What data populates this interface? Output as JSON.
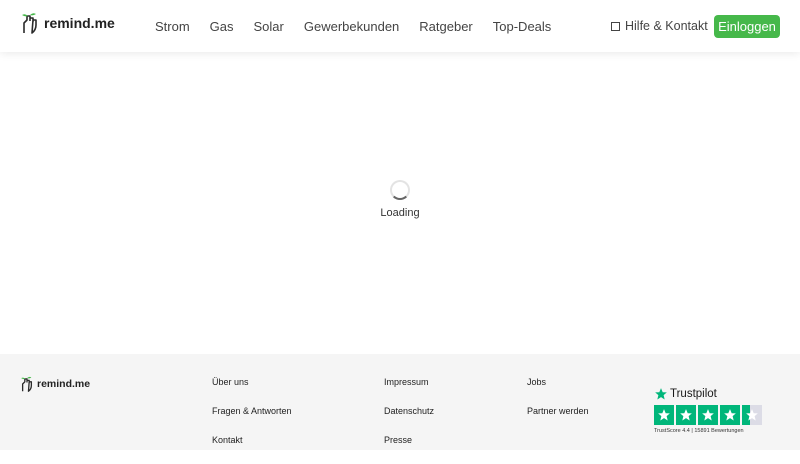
{
  "header": {
    "logo_text": "remind.me",
    "logo_icon": "hand-plant-icon",
    "nav": [
      {
        "label": "Strom"
      },
      {
        "label": "Gas"
      },
      {
        "label": "Solar"
      },
      {
        "label": "Gewerbekunden"
      },
      {
        "label": "Ratgeber"
      },
      {
        "label": "Top-Deals"
      }
    ],
    "help_label": "Hilfe & Kontakt",
    "help_icon": "checkbox-square-icon",
    "login_label": "Einloggen"
  },
  "main": {
    "loading_text": "Loading"
  },
  "footer": {
    "logo_text": "remind.me",
    "col1": [
      {
        "label": "Über uns"
      },
      {
        "label": "Fragen & Antworten"
      },
      {
        "label": "Kontakt"
      }
    ],
    "col2": [
      {
        "label": "Impressum"
      },
      {
        "label": "Datenschutz"
      },
      {
        "label": "Presse"
      }
    ],
    "col3": [
      {
        "label": "Jobs"
      },
      {
        "label": "Partner werden"
      }
    ],
    "trustpilot": {
      "name": "Trustpilot",
      "stars": 4.4,
      "score_text": "TrustScore 4.4 | 15891 Bewertungen"
    }
  },
  "colors": {
    "accent_green": "#46b84a",
    "trustpilot_green": "#00b67a",
    "footer_bg": "#f5f5f5"
  }
}
